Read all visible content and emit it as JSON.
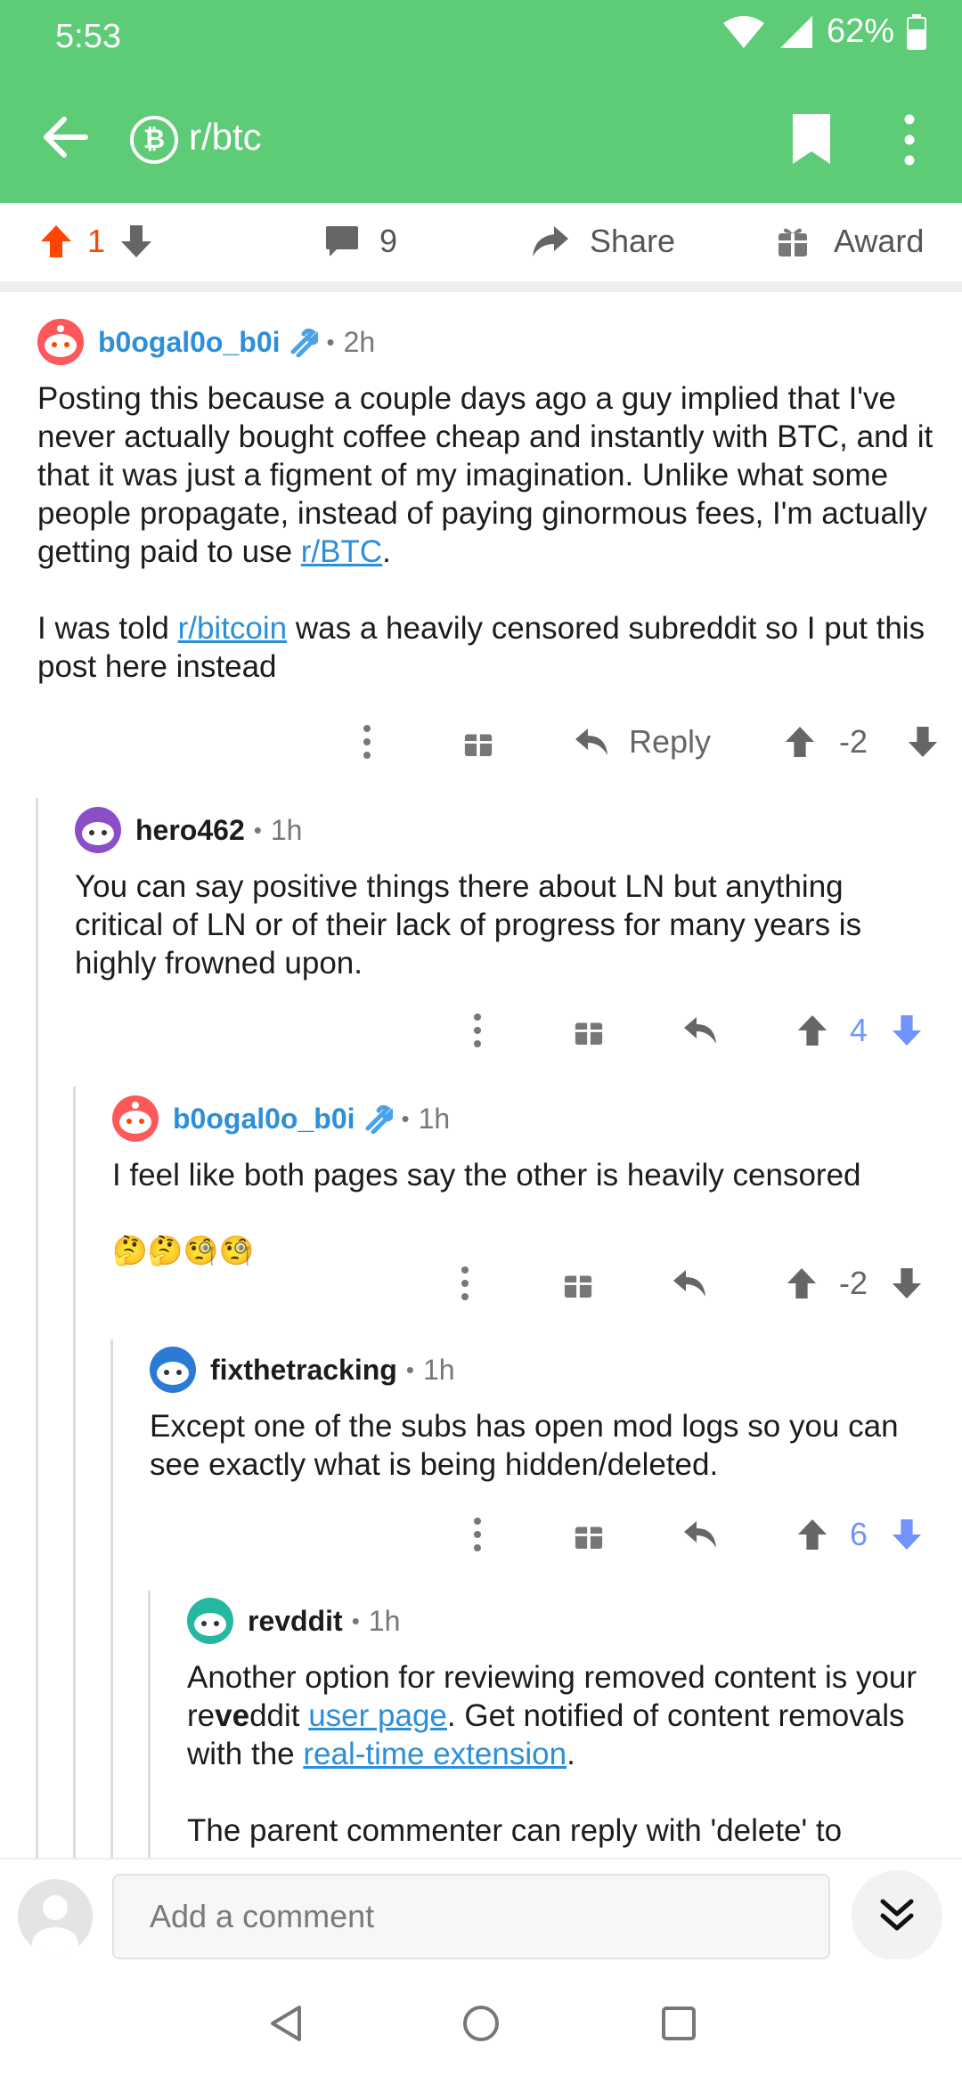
{
  "status_bar": {
    "time": "5:53",
    "battery": "62%"
  },
  "toolbar": {
    "subreddit": "r/btc",
    "subreddit_icon": "bitcoin-icon"
  },
  "post_actions": {
    "score": "1",
    "comments": "9",
    "share_label": "Share",
    "award_label": "Award"
  },
  "comments": [
    {
      "author": "b0ogal0o_b0i",
      "age": "2h",
      "is_op": true,
      "paragraphs": [
        [
          "Posting this because a couple days ago a guy implied that I've never actually bought coffee cheap and instantly with BTC, and it that it was just a figment of my imagination. Unlike what some people propagate, instead of paying ginormous fees, I'm actually getting paid to use ",
          "r/BTC",
          "."
        ],
        [
          "I was told ",
          "r/bitcoin",
          " was a heavily censored subreddit so I put this post here instead"
        ]
      ],
      "reply_label": "Reply",
      "score": "-2"
    },
    {
      "author": "hero462",
      "age": "1h",
      "text": "You can say positive things there about LN but anything critical of LN or of their lack of progress for many years is highly frowned upon.",
      "score": "4"
    },
    {
      "author": "b0ogal0o_b0i",
      "age": "1h",
      "is_op": true,
      "text": "I feel like both pages say the other is heavily censored",
      "emoji": "🤔🤔🧐🧐",
      "score": "-2"
    },
    {
      "author": "fixthetracking",
      "age": "1h",
      "text": "Except one of the subs has open mod logs so you can see exactly what is being hidden/deleted.",
      "score": "6"
    },
    {
      "author": "revddit",
      "age": "1h",
      "p1": {
        "a": "Another option for reviewing removed content is your re",
        "b": "ve",
        "c": "ddit ",
        "link1": "user page",
        "d": ". Get notified of content removals with the ",
        "link2": "real-time extension",
        "e": "."
      },
      "p2": "The parent commenter can reply with 'delete' to"
    }
  ],
  "composer": {
    "placeholder": "Add a comment"
  },
  "colors": {
    "header": "#5ecb76",
    "upvote_active": "#ff4500",
    "downvote_active": "#7193ff",
    "link": "#2c8fd8"
  }
}
